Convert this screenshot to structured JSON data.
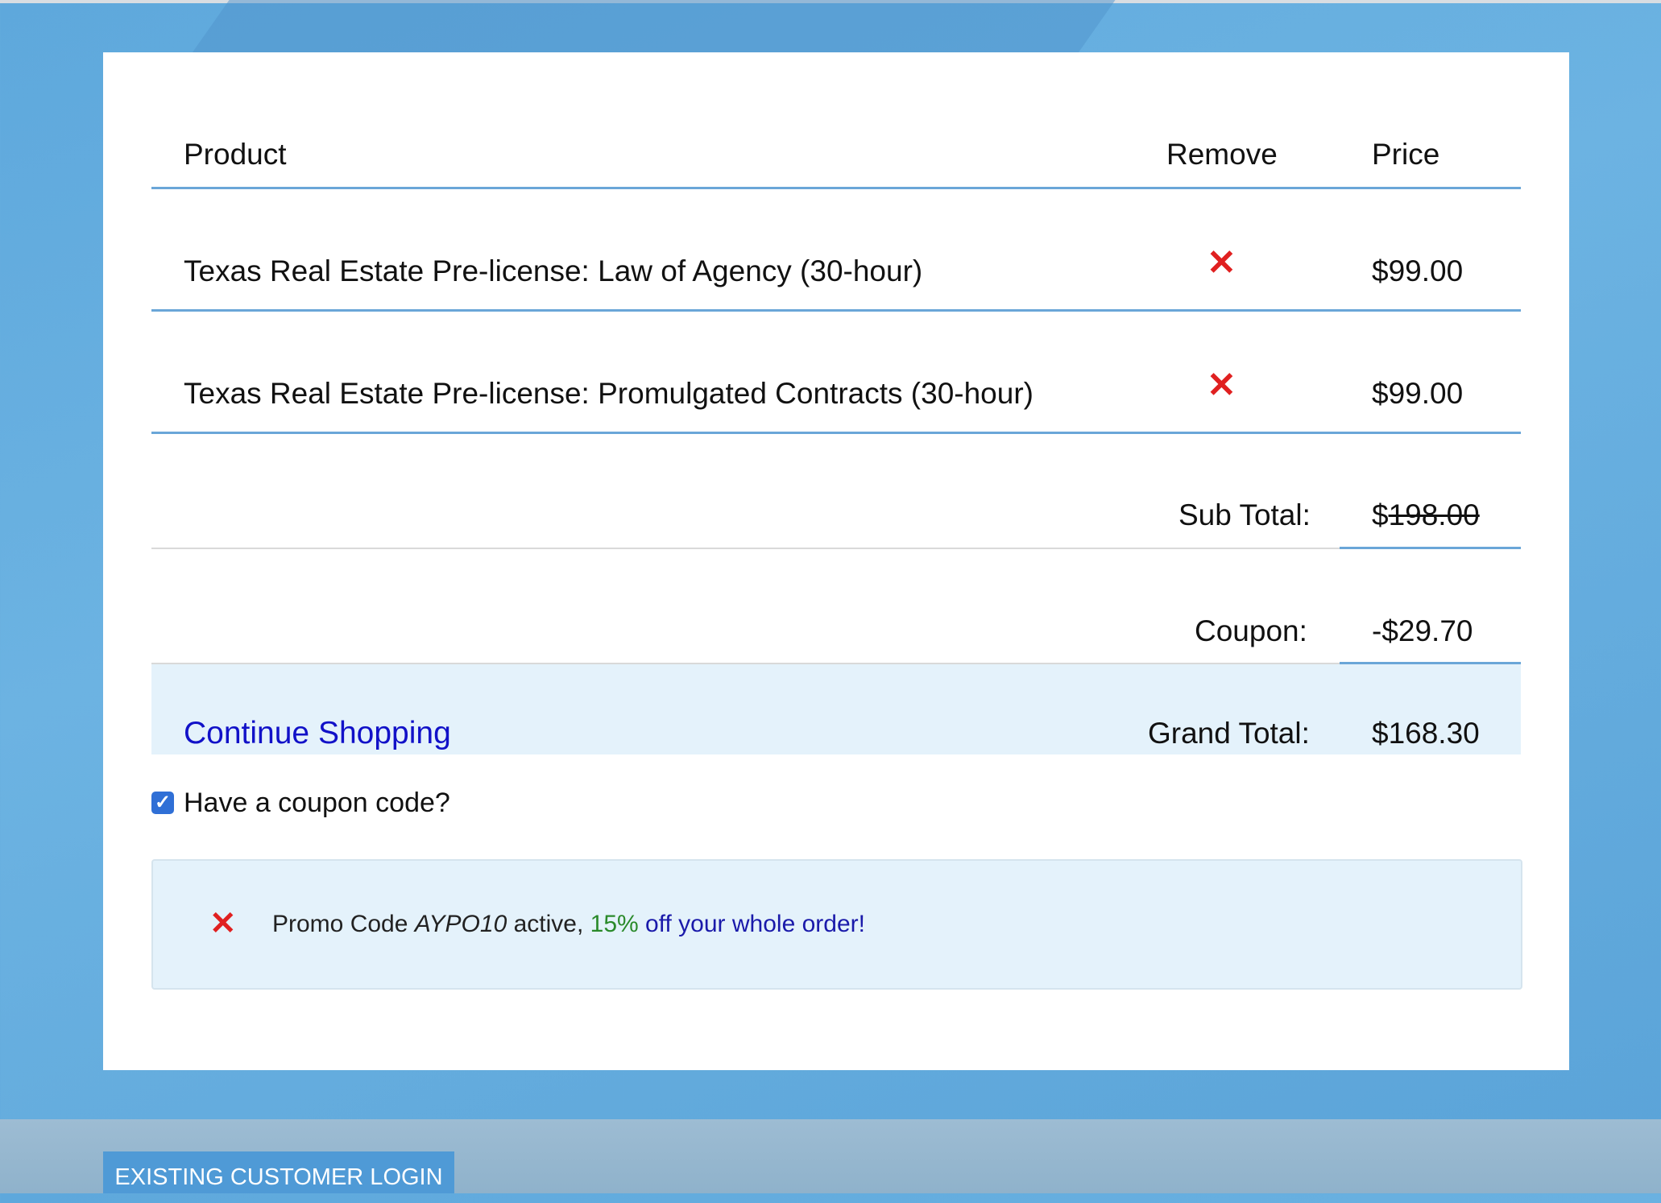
{
  "colors": {
    "accent_line": "#6aa6d8",
    "remove_icon": "#e02020",
    "link": "#1111c8",
    "highlight_bg": "#e4f2fb",
    "discount_green": "#2a8a2a"
  },
  "cart": {
    "headers": {
      "product": "Product",
      "remove": "Remove",
      "price": "Price"
    },
    "items": [
      {
        "name": "Texas Real Estate Pre-license: Law of Agency (30-hour)",
        "remove_icon": "close-x-icon",
        "price": "$99.00"
      },
      {
        "name": "Texas Real Estate Pre-license: Promulgated Contracts (30-hour)",
        "remove_icon": "close-x-icon",
        "price": "$99.00"
      }
    ],
    "subtotal_label": "Sub Total:",
    "subtotal_currency": "$",
    "subtotal_value": "198.00",
    "coupon_label": "Coupon:",
    "coupon_value": "-$29.70",
    "grand_total_label": "Grand Total:",
    "grand_total_value": "$168.30",
    "continue_shopping": "Continue Shopping"
  },
  "coupon": {
    "checkbox_label": "Have a coupon code?",
    "checked": true,
    "promo_prefix": "Promo Code ",
    "promo_code": "AYPO10",
    "promo_middle": " active, ",
    "promo_percent": "15%",
    "promo_suffix": " off your whole order!"
  },
  "footer": {
    "login_button": "EXISTING CUSTOMER LOGIN"
  }
}
